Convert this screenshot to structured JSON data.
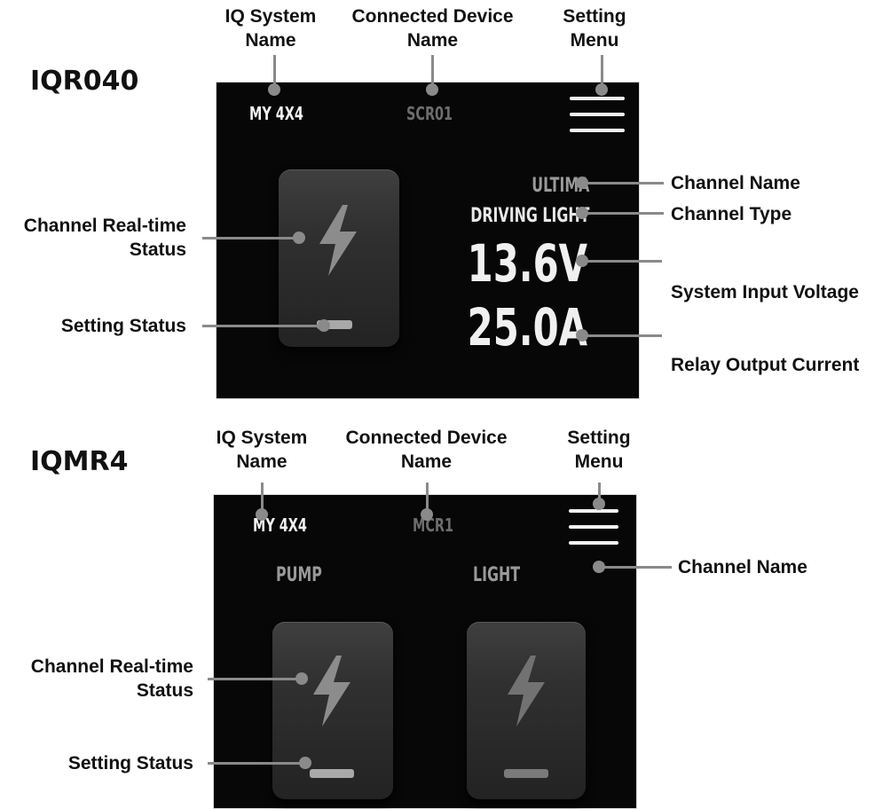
{
  "panels": [
    {
      "model": "IQR040",
      "callouts": {
        "system_name": [
          "IQ System",
          "Name"
        ],
        "device_name": [
          "Connected Device",
          "Name"
        ],
        "setting_menu": [
          "Setting",
          "Menu"
        ],
        "channel_name": "Channel Name",
        "channel_type": "Channel Type",
        "input_voltage": "System Input Voltage",
        "output_current": "Relay Output Current",
        "realtime_status": [
          "Channel Real-time",
          "Status"
        ],
        "setting_status": "Setting Status"
      },
      "screen": {
        "system_name": "MY 4X4",
        "device_name": "SCR01",
        "channel_name": "ULTIMA",
        "channel_type": "DRIVING LIGHT",
        "voltage": "13.6V",
        "current": "25.0A"
      }
    },
    {
      "model": "IQMR4",
      "callouts": {
        "system_name": [
          "IQ System",
          "Name"
        ],
        "device_name": [
          "Connected Device",
          "Name"
        ],
        "setting_menu": [
          "Setting",
          "Menu"
        ],
        "channel_name": "Channel Name",
        "realtime_status": [
          "Channel Real-time",
          "Status"
        ],
        "setting_status": "Setting Status"
      },
      "screen": {
        "system_name": "MY 4X4",
        "device_name": "MCR1",
        "channels": [
          "PUMP",
          "LIGHT"
        ]
      }
    }
  ],
  "icons": [
    "lightning-bolt-icon",
    "menu-icon",
    "status-indicator-icon"
  ],
  "colors": {
    "screen": "#070707",
    "leader_line": "#8a8a8a",
    "lcd_text": "#f0f0f0",
    "lcd_dim": "#6d6d6d"
  }
}
